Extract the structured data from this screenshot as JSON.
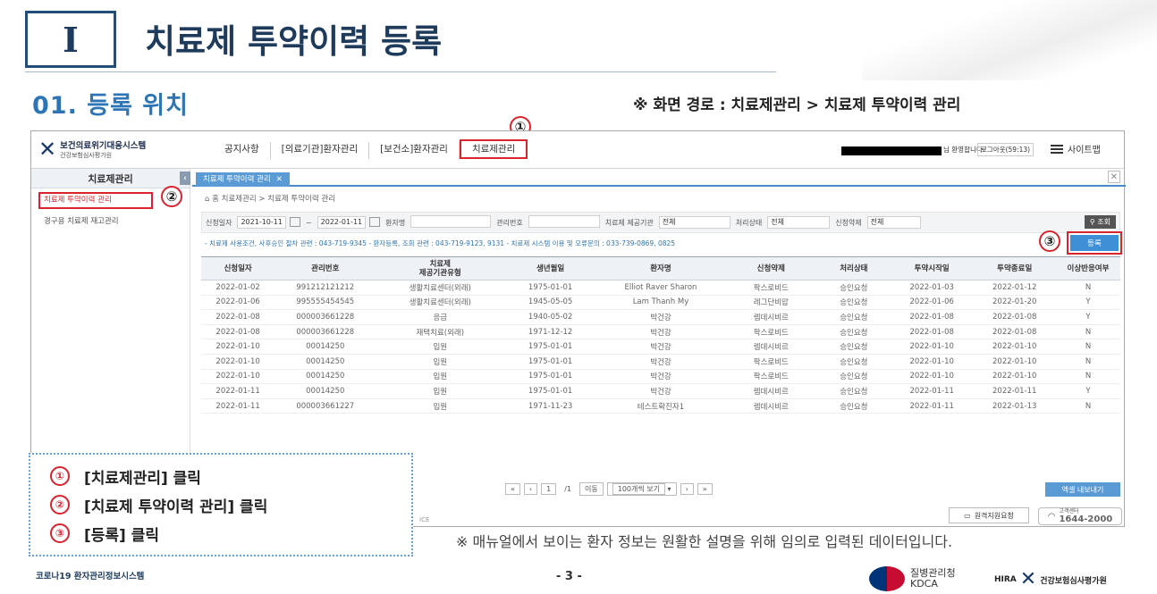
{
  "slide": {
    "section_mark": "I",
    "section_title": "치료제 투약이력 등록",
    "subtitle": "01. 등록 위치",
    "screen_path": "※ 화면 경로 : 치료제관리 > 치료제 투약이력 관리",
    "markers": [
      "①",
      "②",
      "③"
    ],
    "instructions": [
      {
        "num": "①",
        "text": "[치료제관리] 클릭"
      },
      {
        "num": "②",
        "text": "[치료제 투약이력 관리] 클릭"
      },
      {
        "num": "③",
        "text": "[등록] 클릭"
      }
    ],
    "manual_note": "※ 매뉴얼에서 보이는 환자 정보는 원활한 설명을 위해 임의로 입력된 데이터입니다.",
    "footer_left_prefix": "코로나19",
    "footer_left": "환자관리정보시스템",
    "page_number": "- 3 -",
    "kdca_name": "질병관리청",
    "kdca_en": "KDCA",
    "hira_prefix": "HIRA",
    "hira_name": "건강보험심사평가원"
  },
  "app": {
    "logo_title": "보건의료위기대응시스템",
    "logo_sub": "건강보험심사평가원",
    "nav": [
      "공지사항",
      "[의료기관]환자관리",
      "[보건소]환자관리",
      "치료제관리"
    ],
    "user_greeting": "님 환영합니다",
    "logout": "로그아웃(59:13)",
    "sitemap": "사이트맵",
    "sidebar_title": "치료제관리",
    "sidebar_items": [
      "치료제 투약이력 관리",
      "경구용 치료제 재고관리"
    ],
    "tab_label": "치료제 투약이력 관리",
    "breadcrumb": "홈 치료제관리 > 치료제 투약이력 관리",
    "filters": {
      "apply_date_label": "신청일자",
      "date_from": "2021-10-11",
      "date_to": "2022-01-11",
      "patient_label": "환자명",
      "mgmt_label": "관리번호",
      "provider_label": "치료제 제공기관",
      "provider_value": "전체",
      "status_label": "처리상태",
      "status_value": "전체",
      "drug_label": "신청약제",
      "drug_value": "전체",
      "search_btn": "조회"
    },
    "notice": "- 치료제 사용조건, 사후승인 절차 관련 : 043-719-9345     - 환자등록, 조회 관련 : 043-719-9123, 9131     - 치료제 시스템 이용 및 오류문의 : 033-739-0869, 0825",
    "register_btn": "등록",
    "table": {
      "headers": [
        "신청일자",
        "관리번호",
        "치료제\n제공기관유형",
        "생년월일",
        "환자명",
        "신청약제",
        "처리상태",
        "투약시작일",
        "투약종료일",
        "이상반응여부"
      ],
      "rows": [
        [
          "2022-01-02",
          "991212121212",
          "생활치료센터(외래)",
          "1975-01-01",
          "Elliot Raver Sharon",
          "팍스로비드",
          "승인요청",
          "2022-01-03",
          "2022-01-12",
          "N"
        ],
        [
          "2022-01-06",
          "995555454545",
          "생활치료센터(외래)",
          "1945-05-05",
          "Lam Thanh My",
          "레그단비맙",
          "승인요청",
          "2022-01-06",
          "2022-01-20",
          "Y"
        ],
        [
          "2022-01-08",
          "000003661228",
          "응급",
          "1940-05-02",
          "박건강",
          "렘데시비르",
          "승인요청",
          "2022-01-08",
          "2022-01-08",
          "Y"
        ],
        [
          "2022-01-08",
          "000003661228",
          "재택치료(외래)",
          "1971-12-12",
          "박건강",
          "팍스로비드",
          "승인요청",
          "2022-01-08",
          "2022-01-08",
          "N"
        ],
        [
          "2022-01-10",
          "00014250",
          "입원",
          "1975-01-01",
          "박건강",
          "렘데시비르",
          "승인요청",
          "2022-01-10",
          "2022-01-10",
          "N"
        ],
        [
          "2022-01-10",
          "00014250",
          "입원",
          "1975-01-01",
          "박건강",
          "팍스로비드",
          "승인요청",
          "2022-01-10",
          "2022-01-10",
          "N"
        ],
        [
          "2022-01-10",
          "00014250",
          "입원",
          "1975-01-01",
          "박건강",
          "팍스로비드",
          "승인요청",
          "2022-01-10",
          "2022-01-10",
          "N"
        ],
        [
          "2022-01-11",
          "00014250",
          "입원",
          "1975-01-01",
          "박건강",
          "렘데시비르",
          "승인요청",
          "2022-01-11",
          "2022-01-11",
          "Y"
        ],
        [
          "2022-01-11",
          "000003661227",
          "입원",
          "1971-11-23",
          "테스트확진자1",
          "렘데시비르",
          "승인요청",
          "2022-01-11",
          "2022-01-13",
          "N"
        ]
      ]
    },
    "pager": {
      "page": "1",
      "total": "/1",
      "go": "이동",
      "per_page": "100개씩 보기"
    },
    "excel_btn": "엑셀 내보내기",
    "remote_support": "원격지원요청",
    "call_center_label": "고객센터",
    "call_center_number": "1644-2000",
    "rice_fragment": "ICE"
  }
}
